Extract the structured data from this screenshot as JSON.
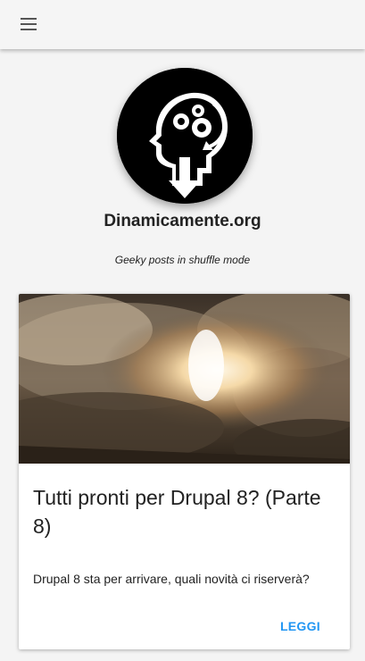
{
  "header": {
    "menu_icon": "hamburger-menu-icon"
  },
  "branding": {
    "logo_icon": "head-gears-logo",
    "site_name": "Dinamicamente.org",
    "slogan": "Geeky posts in shuffle mode"
  },
  "article": {
    "image_icon": "rocket-launch-smoke-image",
    "title": "Tutti pronti per Drupal 8? (Parte 8)",
    "summary": "Drupal 8 sta per arrivare, quali novità ci riserverà?",
    "action_label": "LEGGI"
  },
  "colors": {
    "accent": "#2196f3",
    "background": "#f4f4f4",
    "text": "#222222"
  }
}
